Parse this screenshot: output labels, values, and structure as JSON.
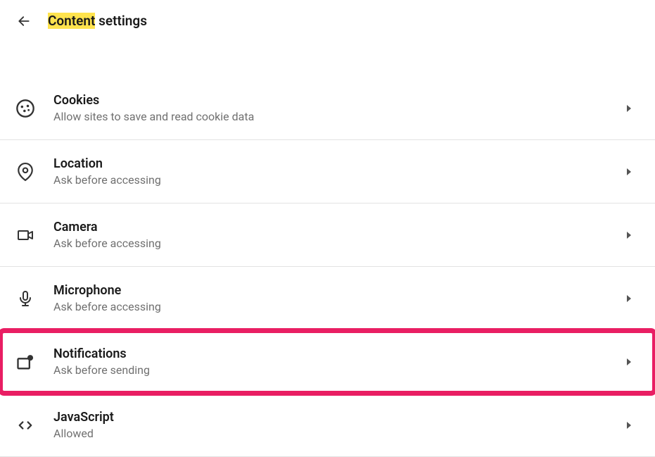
{
  "header": {
    "title_highlighted": "Content",
    "title_rest": " settings"
  },
  "items": {
    "cookies": {
      "title": "Cookies",
      "desc": "Allow sites to save and read cookie data"
    },
    "location": {
      "title": "Location",
      "desc": "Ask before accessing"
    },
    "camera": {
      "title": "Camera",
      "desc": "Ask before accessing"
    },
    "microphone": {
      "title": "Microphone",
      "desc": "Ask before accessing"
    },
    "notifications": {
      "title": "Notifications",
      "desc": "Ask before sending"
    },
    "javascript": {
      "title": "JavaScript",
      "desc": "Allowed"
    }
  }
}
